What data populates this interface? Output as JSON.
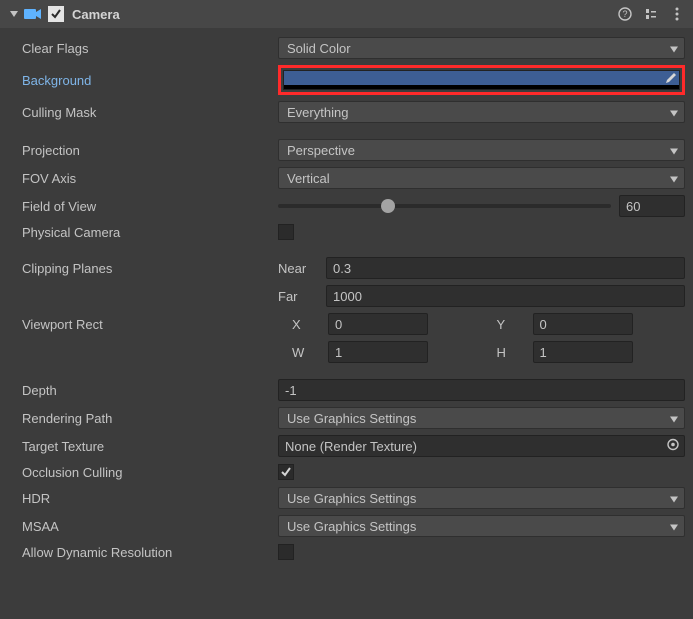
{
  "header": {
    "title": "Camera",
    "enabled": true
  },
  "clearFlags": {
    "label": "Clear Flags",
    "value": "Solid Color"
  },
  "background": {
    "label": "Background",
    "color": "#3d5e94"
  },
  "cullingMask": {
    "label": "Culling Mask",
    "value": "Everything"
  },
  "projection": {
    "label": "Projection",
    "value": "Perspective"
  },
  "fovAxis": {
    "label": "FOV Axis",
    "value": "Vertical"
  },
  "fieldOfView": {
    "label": "Field of View",
    "value": "60",
    "sliderPercent": 33
  },
  "physicalCamera": {
    "label": "Physical Camera",
    "checked": false
  },
  "clippingPlanes": {
    "label": "Clipping Planes",
    "nearLabel": "Near",
    "near": "0.3",
    "farLabel": "Far",
    "far": "1000"
  },
  "viewportRect": {
    "label": "Viewport Rect",
    "xLabel": "X",
    "x": "0",
    "yLabel": "Y",
    "y": "0",
    "wLabel": "W",
    "w": "1",
    "hLabel": "H",
    "h": "1"
  },
  "depth": {
    "label": "Depth",
    "value": "-1"
  },
  "renderingPath": {
    "label": "Rendering Path",
    "value": "Use Graphics Settings"
  },
  "targetTexture": {
    "label": "Target Texture",
    "value": "None (Render Texture)"
  },
  "occlusionCulling": {
    "label": "Occlusion Culling",
    "checked": true
  },
  "hdr": {
    "label": "HDR",
    "value": "Use Graphics Settings"
  },
  "msaa": {
    "label": "MSAA",
    "value": "Use Graphics Settings"
  },
  "allowDynamicResolution": {
    "label": "Allow Dynamic Resolution",
    "checked": false
  }
}
